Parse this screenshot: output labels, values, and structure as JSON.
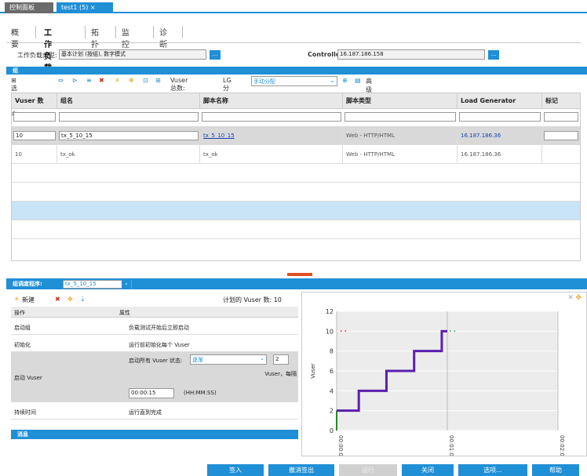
{
  "doc_tabs": [
    {
      "label": "控制面板"
    },
    {
      "label": "test1 (5) ×"
    }
  ],
  "view_tabs": [
    "概要",
    "工作负载",
    "拓扑",
    "监控器",
    "诊断"
  ],
  "workload": {
    "type_label": "工作负载类型:",
    "type_value": "基本计划 (按组), 数字模式",
    "controller_label": "Controller:",
    "controller_value": "16.187.186.158",
    "browse": "..."
  },
  "group_bar": "组",
  "toolbar": {
    "select_script": "选择脚本",
    "vuser_total": "Vuser 总数: 20",
    "lg_assign": "LG 分配:",
    "lg_mode": "手动分配",
    "advanced": "高级"
  },
  "table": {
    "headers": [
      "Vuser 数",
      "组名",
      "脚本名称",
      "脚本类型",
      "Load Generator",
      "标记"
    ],
    "rows": [
      {
        "vusers": "10",
        "group": "tx_5_10_15",
        "script": "tx_5_10_15",
        "type": "Web - HTTP/HTML",
        "lg": "16.187.186.36",
        "tag": ""
      },
      {
        "vusers": "10",
        "group": "tx_ok",
        "script": "tx_ok",
        "type": "Web - HTTP/HTML",
        "lg": "16.187.186.36",
        "tag": ""
      }
    ]
  },
  "schedule": {
    "label": "组调度程序:",
    "group": "tx_5_10_15",
    "new": "新建",
    "planned": "计划的 Vuser 数: 10",
    "col_op": "操作",
    "col_prop": "属性",
    "rows": [
      {
        "op": "启动组",
        "prop": "负载测试开始后立即启动"
      },
      {
        "op": "初始化",
        "prop": "运行前初始化每个 Vuser"
      },
      {
        "op": "启动 Vuser",
        "prop": "启动所有 Vuser 状态:",
        "mode": "逐渐",
        "count": "2",
        "unit": "Vuser，每隔",
        "time": "00:00:15",
        "time_fmt": "(HH:MM:SS)"
      },
      {
        "op": "持续时间",
        "prop": "运行直到完成"
      }
    ],
    "messages": "消息"
  },
  "chart_data": {
    "type": "line",
    "ylabel": "Vuser",
    "y_ticks": [
      "0",
      "2",
      "4",
      "6",
      "8",
      "10",
      "12"
    ],
    "x_ticks": [
      "00:00:00",
      "00:01:00",
      "00:02:00"
    ],
    "ylim": [
      0,
      12
    ],
    "series": [
      {
        "x": [
          0,
          0.2,
          0.2,
          0.45,
          0.45,
          0.7,
          0.7,
          0.95,
          0.95,
          1.0
        ],
        "y": [
          2,
          2,
          4,
          4,
          6,
          6,
          8,
          8,
          10,
          10
        ]
      }
    ]
  },
  "bottom_buttons": [
    "签入",
    "撤消签出",
    "运行",
    "关闭",
    "选项...",
    "帮助"
  ],
  "colors": {
    "accent": "#1f8fd6",
    "line": "#5a1fae",
    "highlight": "#c8e4f6"
  }
}
